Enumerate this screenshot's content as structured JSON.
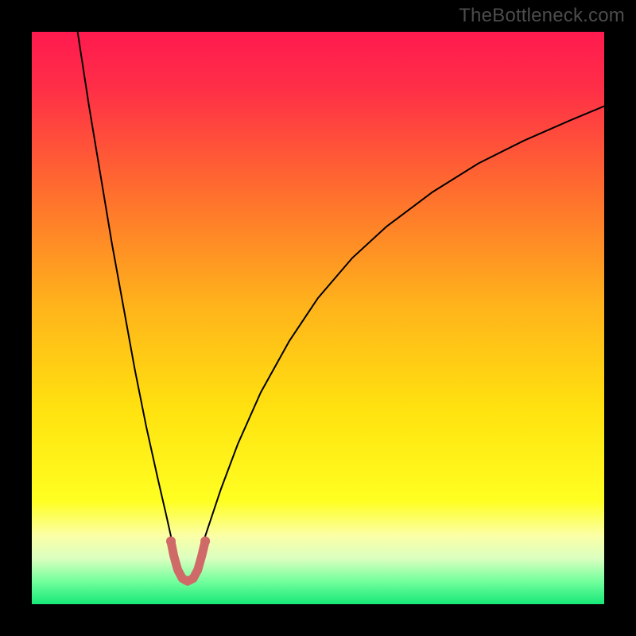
{
  "watermark": "TheBottleneck.com",
  "chart_data": {
    "type": "line",
    "title": "",
    "xlabel": "",
    "ylabel": "",
    "xlim": [
      0,
      100
    ],
    "ylim": [
      0,
      100
    ],
    "grid": false,
    "legend": false,
    "gradient_stops": [
      {
        "offset": 0.0,
        "color": "#ff1a4f"
      },
      {
        "offset": 0.1,
        "color": "#ff2f47"
      },
      {
        "offset": 0.28,
        "color": "#ff6e2e"
      },
      {
        "offset": 0.48,
        "color": "#ffb41b"
      },
      {
        "offset": 0.66,
        "color": "#ffe20f"
      },
      {
        "offset": 0.82,
        "color": "#ffff22"
      },
      {
        "offset": 0.88,
        "color": "#fbffa6"
      },
      {
        "offset": 0.92,
        "color": "#dbffc0"
      },
      {
        "offset": 0.96,
        "color": "#73ff9d"
      },
      {
        "offset": 1.0,
        "color": "#17e878"
      }
    ],
    "series": [
      {
        "name": "curve-left",
        "stroke": "#000000",
        "stroke_width": 2,
        "points": [
          {
            "x": 8.0,
            "y": 100.0
          },
          {
            "x": 10.0,
            "y": 87.0
          },
          {
            "x": 12.0,
            "y": 75.0
          },
          {
            "x": 14.0,
            "y": 63.0
          },
          {
            "x": 16.0,
            "y": 52.0
          },
          {
            "x": 18.0,
            "y": 41.0
          },
          {
            "x": 20.0,
            "y": 31.0
          },
          {
            "x": 22.0,
            "y": 22.0
          },
          {
            "x": 23.5,
            "y": 15.5
          },
          {
            "x": 24.5,
            "y": 11.0
          }
        ]
      },
      {
        "name": "curve-right",
        "stroke": "#000000",
        "stroke_width": 2,
        "points": [
          {
            "x": 30.0,
            "y": 11.0
          },
          {
            "x": 31.0,
            "y": 14.0
          },
          {
            "x": 33.0,
            "y": 20.0
          },
          {
            "x": 36.0,
            "y": 28.0
          },
          {
            "x": 40.0,
            "y": 37.0
          },
          {
            "x": 45.0,
            "y": 46.0
          },
          {
            "x": 50.0,
            "y": 53.5
          },
          {
            "x": 56.0,
            "y": 60.5
          },
          {
            "x": 62.0,
            "y": 66.0
          },
          {
            "x": 70.0,
            "y": 72.0
          },
          {
            "x": 78.0,
            "y": 77.0
          },
          {
            "x": 86.0,
            "y": 81.0
          },
          {
            "x": 94.0,
            "y": 84.5
          },
          {
            "x": 100.0,
            "y": 87.0
          }
        ]
      },
      {
        "name": "highlight-valley",
        "stroke": "#cf6a68",
        "stroke_width": 11,
        "linecap": "round",
        "points": [
          {
            "x": 24.3,
            "y": 11.0
          },
          {
            "x": 24.8,
            "y": 8.5
          },
          {
            "x": 25.5,
            "y": 6.0
          },
          {
            "x": 26.3,
            "y": 4.5
          },
          {
            "x": 27.2,
            "y": 4.0
          },
          {
            "x": 28.2,
            "y": 4.5
          },
          {
            "x": 29.0,
            "y": 6.0
          },
          {
            "x": 29.7,
            "y": 8.5
          },
          {
            "x": 30.3,
            "y": 11.0
          }
        ]
      }
    ],
    "markers": [
      {
        "series": "highlight-valley",
        "x": 24.3,
        "y": 11.0,
        "r": 6,
        "fill": "#cf6a68"
      },
      {
        "series": "highlight-valley",
        "x": 30.3,
        "y": 11.0,
        "r": 6,
        "fill": "#cf6a68"
      }
    ]
  }
}
